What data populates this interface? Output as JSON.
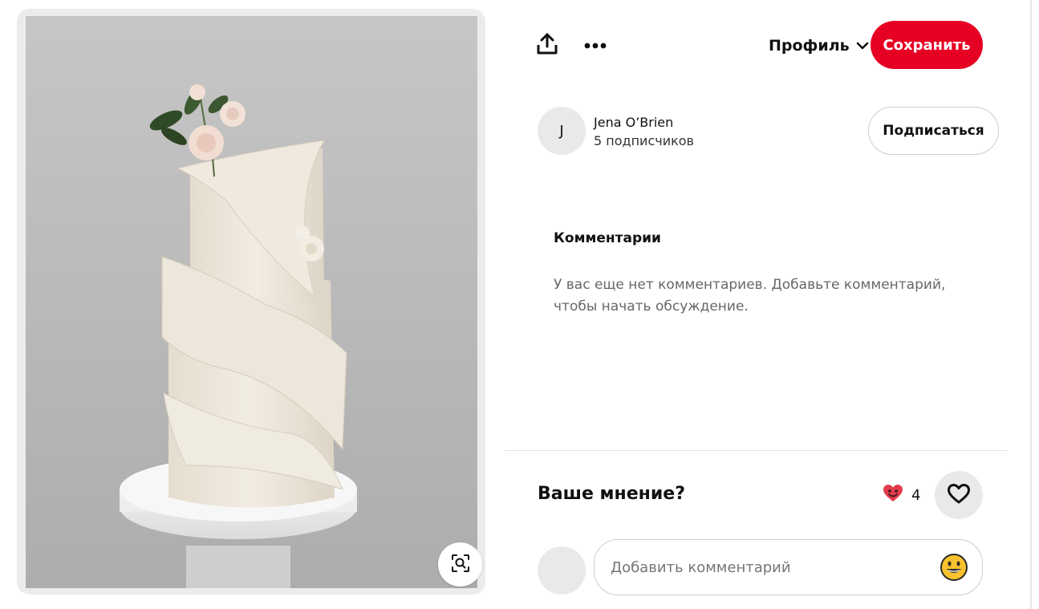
{
  "toolbar": {
    "share_icon": "share-upload-icon",
    "more_icon": "more-dots-icon",
    "profile_label": "Профиль",
    "save_label": "Сохранить",
    "accent_color": "#e60023"
  },
  "author": {
    "initial": "J",
    "name": "Jena O’Brien",
    "followers": "5 подписчиков",
    "follow_label": "Подписаться"
  },
  "comments": {
    "title": "Комментарии",
    "empty_text": "У вас еще нет комментариев. Добавьте комментарий, чтобы начать обсуждение."
  },
  "feedback": {
    "title": "Ваше мнение?",
    "reaction_count": "4",
    "reaction_icon": "heart-eyes-emoji-icon",
    "like_icon": "heart-outline-icon"
  },
  "comment_form": {
    "placeholder": "Добавить комментарий",
    "emoji_icon": "smiley-emoji-icon"
  },
  "image": {
    "subject": "white tiered wedding cake with rose decorations",
    "lens_icon": "visual-search-icon"
  }
}
